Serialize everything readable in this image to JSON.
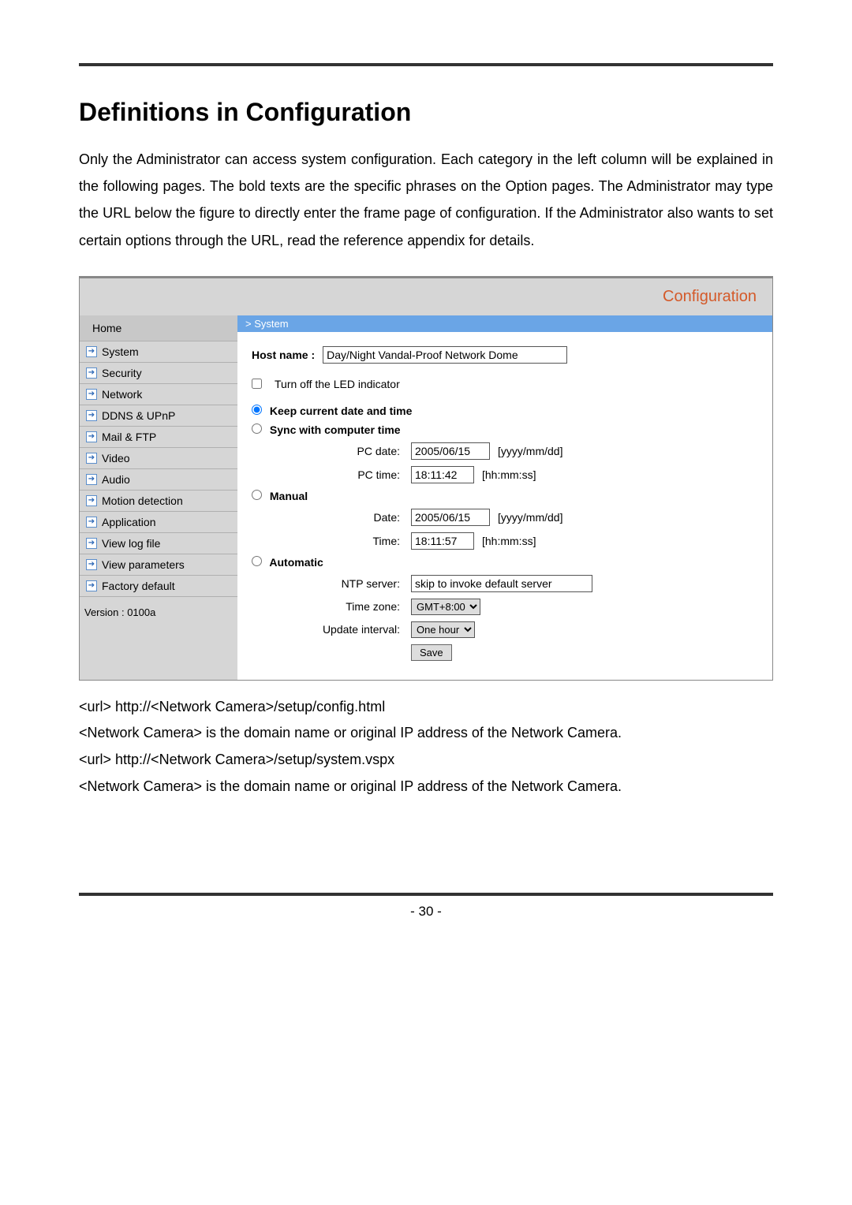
{
  "page": {
    "title": "Definitions in Configuration",
    "intro": "Only the Administrator can access system configuration. Each category in the left column will be explained in the following pages. The bold texts are the specific phrases on the Option pages. The Administrator may type the URL below the figure to directly enter the frame page of configuration. If the Administrator also wants to set certain options through the URL, read the reference appendix for details.",
    "page_number": "- 30 -"
  },
  "config": {
    "header_label": "Configuration",
    "sidebar": {
      "home": "Home",
      "items": [
        "System",
        "Security",
        "Network",
        "DDNS & UPnP",
        "Mail & FTP",
        "Video",
        "Audio",
        "Motion detection",
        "Application",
        "View log file",
        "View parameters",
        "Factory default"
      ],
      "version": "Version : 0100a"
    },
    "main": {
      "breadcrumb": "> System",
      "host_name_label": "Host name :",
      "host_name_value": "Day/Night Vandal-Proof Network Dome",
      "led_checkbox_label": "Turn off the LED indicator",
      "radio": {
        "keep": "Keep current date and time",
        "sync": "Sync with computer time",
        "manual": "Manual",
        "automatic": "Automatic"
      },
      "sync_block": {
        "pc_date_label": "PC date:",
        "pc_date_value": "2005/06/15",
        "pc_date_hint": "[yyyy/mm/dd]",
        "pc_time_label": "PC time:",
        "pc_time_value": "18:11:42",
        "pc_time_hint": "[hh:mm:ss]"
      },
      "manual_block": {
        "date_label": "Date:",
        "date_value": "2005/06/15",
        "date_hint": "[yyyy/mm/dd]",
        "time_label": "Time:",
        "time_value": "18:11:57",
        "time_hint": "[hh:mm:ss]"
      },
      "auto_block": {
        "ntp_label": "NTP server:",
        "ntp_value": "skip to invoke default server",
        "tz_label": "Time zone:",
        "tz_value": "GMT+8:00",
        "update_label": "Update interval:",
        "update_value": "One hour"
      },
      "save_label": "Save"
    }
  },
  "tail": {
    "l1": "<url> http://<Network Camera>/setup/config.html",
    "l2": "<Network Camera> is the domain name or original IP address of the Network Camera.",
    "l3": "<url> http://<Network Camera>/setup/system.vspx",
    "l4": "<Network Camera> is the domain name or original IP address of the Network Camera."
  }
}
